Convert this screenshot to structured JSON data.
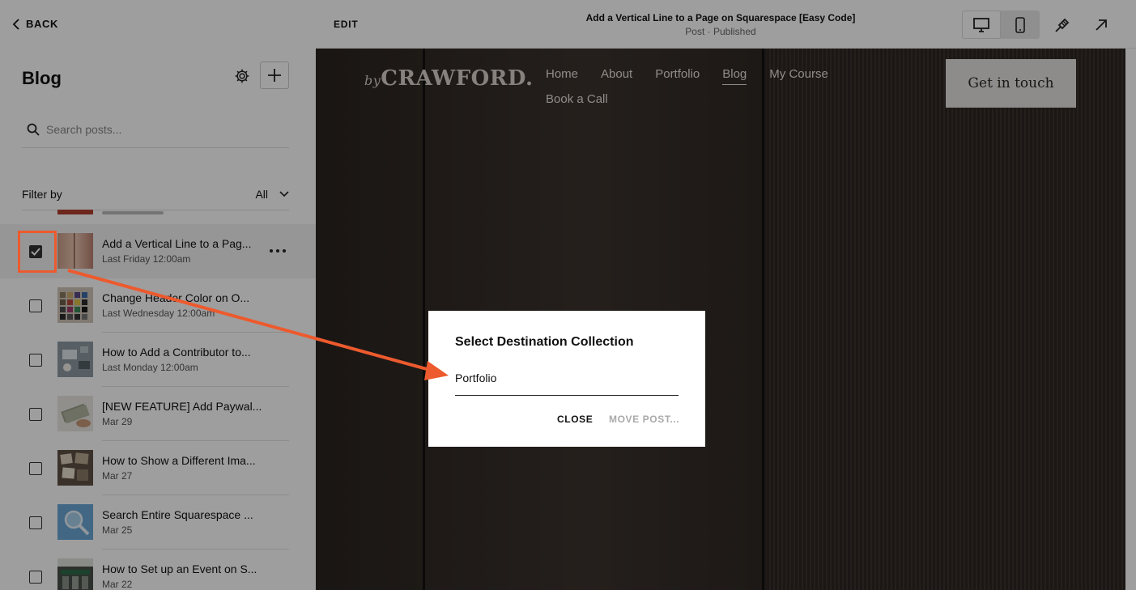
{
  "sidebar": {
    "back_label": "BACK",
    "title": "Blog",
    "search_placeholder": "Search posts...",
    "filter_label": "Filter by",
    "filter_value": "All",
    "posts": [
      {
        "title": "Add a Vertical Line to a Pag...",
        "date": "Last Friday 12:00am",
        "selected": true,
        "thumb": "peach-gradient"
      },
      {
        "title": "Change Header Color on O...",
        "date": "Last Wednesday 12:00am",
        "selected": false,
        "thumb": "color-swatches"
      },
      {
        "title": "How to Add a Contributor to...",
        "date": "Last Monday 12:00am",
        "selected": false,
        "thumb": "desk-laptop"
      },
      {
        "title": "[NEW FEATURE] Add Paywal...",
        "date": "Mar 29",
        "selected": false,
        "thumb": "cash-hand"
      },
      {
        "title": "How to Show a Different Ima...",
        "date": "Mar 27",
        "selected": false,
        "thumb": "photo-collage"
      },
      {
        "title": "Search Entire Squarespace ...",
        "date": "Mar 25",
        "selected": false,
        "thumb": "magnifier-blue"
      },
      {
        "title": "How to Set up an Event on S...",
        "date": "Mar 22",
        "selected": false,
        "thumb": "storefront"
      }
    ]
  },
  "topbar": {
    "edit_label": "EDIT",
    "post_title": "Add a Vertical Line to a Page on Squarespace [Easy Code]",
    "post_status": "Post · Published",
    "icons": [
      "desktop-icon",
      "mobile-icon",
      "style-brush-icon",
      "open-external-icon"
    ]
  },
  "site": {
    "logo_prefix": "by",
    "logo_text": "CRAWFORD.",
    "nav": [
      "Home",
      "About",
      "Portfolio",
      "Blog",
      "My Course",
      "Book a Call"
    ],
    "nav_current": "Blog",
    "cta_label": "Get in touch"
  },
  "modal": {
    "title": "Select Destination Collection",
    "selected_collection": "Portfolio",
    "close_label": "CLOSE",
    "move_label": "MOVE POST..."
  },
  "colors": {
    "annotation": "#ec5a2e",
    "site_bg": "#2e2824"
  }
}
